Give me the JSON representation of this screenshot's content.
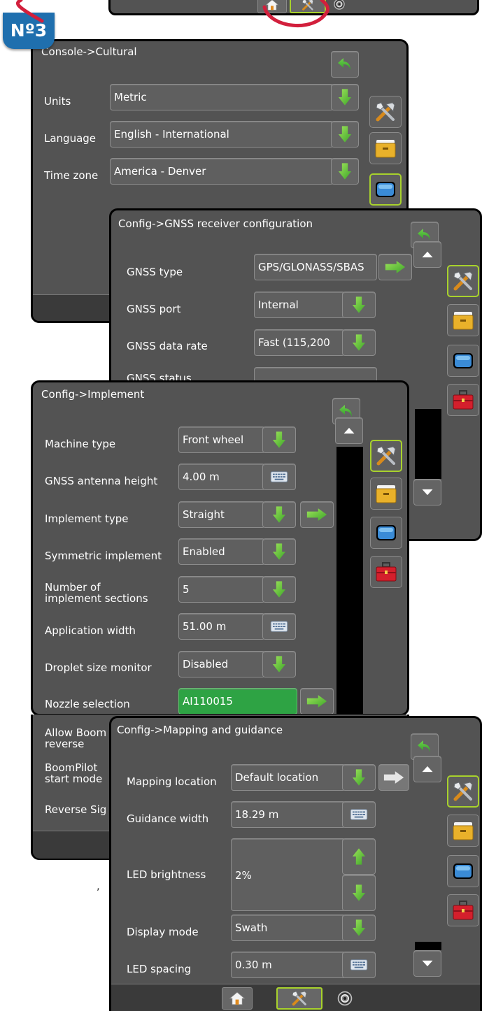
{
  "badge": "Nº3",
  "cultural": {
    "title": "Console->Cultural",
    "rows": [
      {
        "label": "Units",
        "value": "Metric"
      },
      {
        "label": "Language",
        "value": "English - International"
      },
      {
        "label": "Time zone",
        "value": "America - Denver"
      }
    ]
  },
  "gnss": {
    "title": "Config->GNSS receiver configuration",
    "rows": [
      {
        "label": "GNSS type",
        "value": "GPS/GLONASS/SBAS"
      },
      {
        "label": "GNSS port",
        "value": "Internal"
      },
      {
        "label": "GNSS data rate",
        "value": "Fast (115,200"
      },
      {
        "label": "GNSS status",
        "value": ""
      }
    ]
  },
  "implement": {
    "title": "Config->Implement",
    "rows": [
      {
        "label": "Machine type",
        "value": "Front wheel"
      },
      {
        "label": "GNSS antenna height",
        "value": "4.00 m"
      },
      {
        "label": "Implement type",
        "value": "Straight"
      },
      {
        "label": "Symmetric implement",
        "value": "Enabled"
      },
      {
        "label": "Number of implement sections",
        "value": "5"
      },
      {
        "label": "Application width",
        "value": "51.00 m"
      },
      {
        "label": "Droplet size monitor",
        "value": "Disabled"
      },
      {
        "label": "Nozzle selection",
        "value": "AI110015"
      },
      {
        "label": "Allow Boom in reverse",
        "value": ""
      },
      {
        "label": "BoomPilot start mode",
        "value": ""
      },
      {
        "label": "Reverse Sig",
        "value": ""
      }
    ]
  },
  "mapping": {
    "title": "Config->Mapping and guidance",
    "rows": [
      {
        "label": "Mapping location",
        "value": "Default location"
      },
      {
        "label": "Guidance width",
        "value": "18.29 m"
      },
      {
        "label": "LED brightness",
        "value": "2%"
      },
      {
        "label": "Display mode",
        "value": "Swath"
      },
      {
        "label": "LED spacing",
        "value": "0.30 m"
      }
    ]
  },
  "margin_mark": ",",
  "colors": {
    "panel_bg": "#535353",
    "field_bg": "#5f5f5f",
    "accent_green": "#2ea344",
    "active_border": "#a8d22c",
    "badge_blue": "#1f6fae",
    "callout_red": "#d21f3c"
  }
}
